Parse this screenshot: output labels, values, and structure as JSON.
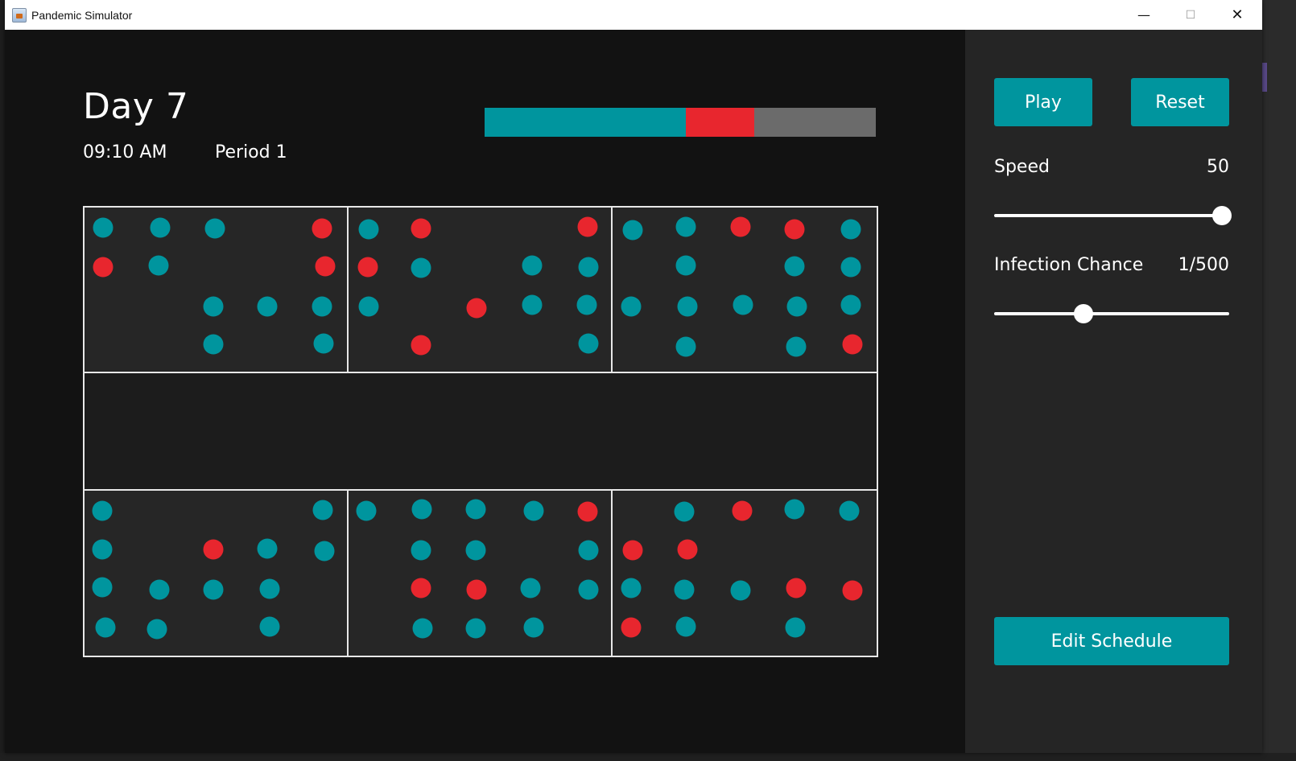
{
  "window": {
    "title": "Pandemic Simulator"
  },
  "colors": {
    "healthy": "#00959e",
    "infected": "#e8262e",
    "recovered": "#6b6b6b",
    "button": "#00959e"
  },
  "status": {
    "day": "Day 7",
    "time": "09:10 AM",
    "period": "Period 1"
  },
  "population_bar": [
    {
      "state": "healthy",
      "fraction": 0.515,
      "color": "#00959e"
    },
    {
      "state": "infected",
      "fraction": 0.175,
      "color": "#e8262e"
    },
    {
      "state": "recovered",
      "fraction": 0.31,
      "color": "#6b6b6b"
    }
  ],
  "controls": {
    "play_label": "Play",
    "reset_label": "Reset",
    "speed_label": "Speed",
    "speed_value": "50",
    "speed_fraction": 0.97,
    "infection_label": "Infection Chance",
    "infection_value": "1/500",
    "infection_fraction": 0.38,
    "edit_schedule_label": "Edit Schedule"
  },
  "rooms": [
    {
      "id": "room-1",
      "dots": [
        [
          "h",
          25,
          27
        ],
        [
          "h",
          96,
          27
        ],
        [
          "h",
          164,
          28
        ],
        [
          "i",
          297,
          28
        ],
        [
          "i",
          25,
          76
        ],
        [
          "h",
          94,
          74
        ],
        [
          "i",
          301,
          75
        ],
        [
          "h",
          162,
          125
        ],
        [
          "h",
          229,
          125
        ],
        [
          "h",
          297,
          125
        ],
        [
          "h",
          162,
          172
        ],
        [
          "h",
          299,
          171
        ]
      ]
    },
    {
      "id": "room-2",
      "dots": [
        [
          "h",
          27,
          29
        ],
        [
          "i",
          92,
          28
        ],
        [
          "i",
          299,
          26
        ],
        [
          "i",
          26,
          76
        ],
        [
          "h",
          92,
          77
        ],
        [
          "h",
          230,
          74
        ],
        [
          "h",
          300,
          76
        ],
        [
          "h",
          27,
          125
        ],
        [
          "i",
          161,
          127
        ],
        [
          "h",
          230,
          123
        ],
        [
          "h",
          298,
          123
        ],
        [
          "i",
          92,
          173
        ],
        [
          "h",
          300,
          171
        ]
      ]
    },
    {
      "id": "room-3",
      "dots": [
        [
          "h",
          27,
          30
        ],
        [
          "h",
          93,
          26
        ],
        [
          "i",
          161,
          26
        ],
        [
          "i",
          228,
          29
        ],
        [
          "h",
          298,
          29
        ],
        [
          "h",
          93,
          74
        ],
        [
          "h",
          228,
          75
        ],
        [
          "h",
          298,
          76
        ],
        [
          "h",
          25,
          125
        ],
        [
          "h",
          95,
          125
        ],
        [
          "h",
          164,
          123
        ],
        [
          "h",
          231,
          125
        ],
        [
          "h",
          298,
          123
        ],
        [
          "h",
          93,
          175
        ],
        [
          "h",
          230,
          175
        ],
        [
          "i",
          300,
          172
        ]
      ]
    },
    {
      "id": "room-4",
      "dots": [
        [
          "h",
          24,
          27
        ],
        [
          "h",
          298,
          26
        ],
        [
          "h",
          24,
          75
        ],
        [
          "i",
          162,
          75
        ],
        [
          "h",
          229,
          74
        ],
        [
          "h",
          300,
          77
        ],
        [
          "h",
          24,
          122
        ],
        [
          "h",
          95,
          125
        ],
        [
          "h",
          162,
          125
        ],
        [
          "h",
          232,
          124
        ],
        [
          "h",
          28,
          172
        ],
        [
          "h",
          92,
          174
        ],
        [
          "h",
          232,
          171
        ]
      ]
    },
    {
      "id": "room-5",
      "dots": [
        [
          "h",
          24,
          27
        ],
        [
          "h",
          93,
          25
        ],
        [
          "h",
          160,
          25
        ],
        [
          "h",
          232,
          27
        ],
        [
          "i",
          299,
          28
        ],
        [
          "h",
          92,
          76
        ],
        [
          "h",
          160,
          76
        ],
        [
          "h",
          300,
          76
        ],
        [
          "i",
          92,
          123
        ],
        [
          "i",
          161,
          125
        ],
        [
          "h",
          228,
          123
        ],
        [
          "h",
          300,
          125
        ],
        [
          "h",
          94,
          173
        ],
        [
          "h",
          160,
          173
        ],
        [
          "h",
          232,
          172
        ]
      ]
    },
    {
      "id": "room-6",
      "dots": [
        [
          "h",
          91,
          28
        ],
        [
          "i",
          163,
          27
        ],
        [
          "h",
          228,
          25
        ],
        [
          "h",
          296,
          27
        ],
        [
          "i",
          27,
          76
        ],
        [
          "i",
          95,
          75
        ],
        [
          "h",
          25,
          123
        ],
        [
          "h",
          91,
          125
        ],
        [
          "h",
          161,
          126
        ],
        [
          "i",
          230,
          123
        ],
        [
          "i",
          300,
          126
        ],
        [
          "i",
          25,
          172
        ],
        [
          "h",
          93,
          171
        ],
        [
          "h",
          229,
          172
        ]
      ]
    }
  ]
}
